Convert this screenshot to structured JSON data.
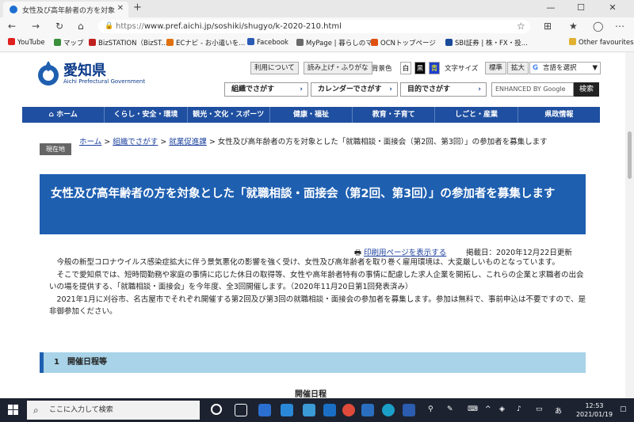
{
  "browser": {
    "tab_title": "女性及び高年齢者の方を対象とし...",
    "new_tab": "+",
    "url_scheme": "https://",
    "url_rest": "www.pref.aichi.jp/soshiki/shugyo/k-2020-210.html",
    "favorites": [
      {
        "label": "YouTube",
        "color": "#e02020"
      },
      {
        "label": "マップ",
        "color": "#3a8f3a"
      },
      {
        "label": "BizSTATION（BizST...",
        "color": "#c02020"
      },
      {
        "label": "ECナビ - お小遣いを...",
        "color": "#e07010"
      },
      {
        "label": "Facebook",
        "color": "#2b5bb5"
      },
      {
        "label": "MyPage | 暮らしのマ...",
        "color": "#6a6a6a"
      },
      {
        "label": "OCNトップページ",
        "color": "#e05010"
      },
      {
        "label": "SBI証券 | 株・FX・投...",
        "color": "#1a4a9a"
      },
      {
        "label": "Other favourites",
        "color": "#e0b030"
      }
    ]
  },
  "site": {
    "logo_jp": "愛知県",
    "logo_en": "Aichi Prefectural Government",
    "util": {
      "usage": "利用について",
      "reading": "読み上げ・ふりがな",
      "bg_label": "背景色",
      "bg_white": "白",
      "bg_black": "黒",
      "bg_blue": "青",
      "fontsize_label": "文字サイズ",
      "fontsize_std": "標準",
      "fontsize_large": "拡大",
      "language": "言語を選択"
    },
    "nav_selects": [
      "組織でさがす",
      "カレンダーでさがす",
      "目的でさがす"
    ],
    "search_placeholder": "ENHANCED BY Google",
    "search_button": "検索",
    "gnav": [
      "ホーム",
      "くらし・安全・環境",
      "観光・文化・スポーツ",
      "健康・福祉",
      "教育・子育て",
      "しごと・産業",
      "県政情報"
    ]
  },
  "breadcrumb": {
    "badge": "現在地",
    "home": "ホーム",
    "org": "組織でさがす",
    "section": "就業促進課",
    "current": "女性及び高年齢者の方を対象とした「就職相談・面接会（第2回、第3回）」の参加者を募集します"
  },
  "article": {
    "title": "女性及び高年齢者の方を対象とした「就職相談・面接会（第2回、第3回）」の参加者を募集します",
    "print_link": "印刷用ページを表示する",
    "date": "掲載日：2020年12月22日更新",
    "paragraphs": [
      "今般の新型コロナウイルス感染症拡大に伴う景気悪化の影響を強く受け、女性及び高年齢者を取り巻く雇用環境は、大変厳しいものとなっています。",
      "そこで愛知県では、短時間勤務や家庭の事情に応じた休日の取得等、女性や高年齢者特有の事情に配慮した求人企業を開拓し、これらの企業と求職者の出会いの場を提供する、「就職相談・面接会」を今年度、全3回開催します。（2020年11月20日第1回発表済み）",
      "2021年1月に刈谷市、名古屋市でそれぞれ開催する第2回及び第3回の就職相談・面接会の参加者を募集します。参加は無料で、事前申込は不要ですので、是非御参加ください。"
    ],
    "section1": "1　開催日程等",
    "schedule_heading": "開催日程"
  },
  "taskbar": {
    "search_placeholder": "ここに入力して検索",
    "time": "12:53",
    "date": "2021/01/19"
  }
}
